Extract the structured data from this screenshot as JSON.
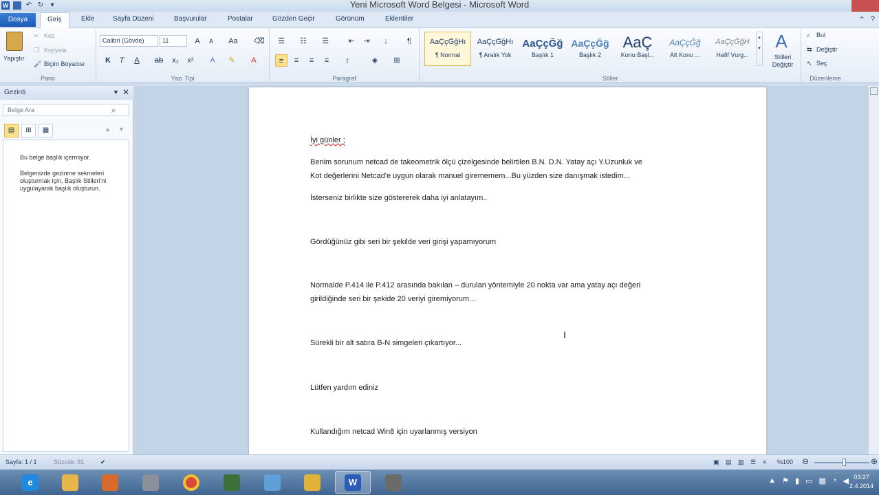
{
  "window": {
    "title": "Yeni Microsoft Word Belgesi - Microsoft Word"
  },
  "tabs": [
    {
      "label": "Dosya"
    },
    {
      "label": "Giriş"
    },
    {
      "label": "Ekle"
    },
    {
      "label": "Sayfa Düzeni"
    },
    {
      "label": "Başvurular"
    },
    {
      "label": "Postalar"
    },
    {
      "label": "Gözden Geçir"
    },
    {
      "label": "Görünüm"
    },
    {
      "label": "Eklentiler"
    }
  ],
  "clipboard": {
    "paste": "Yapıştır",
    "cut": "Kes",
    "copy": "Kopyala",
    "format_painter": "Biçim Boyacısı",
    "group": "Pano"
  },
  "font": {
    "name": "Calibri (Gövde)",
    "size": "11",
    "group": "Yazı Tipi"
  },
  "paragraph": {
    "group": "Paragraf"
  },
  "styles": {
    "group": "Stiller",
    "items": [
      {
        "preview": "AaÇçĞğHı",
        "name": "¶ Normal"
      },
      {
        "preview": "AaÇçĞğHı",
        "name": "¶ Aralık Yok"
      },
      {
        "preview": "AaÇçĞğ",
        "name": "Başlık 1"
      },
      {
        "preview": "AaÇçĞğ",
        "name": "Başlık 2"
      },
      {
        "preview": "AaÇ",
        "name": "Konu Başl..."
      },
      {
        "preview": "AaÇçĞğ",
        "name": "Alt Konu ..."
      },
      {
        "preview": "AaÇçĞğH",
        "name": "Hafif Vurg..."
      }
    ],
    "change": "Stilleri Değiştir"
  },
  "editing": {
    "find": "Bul",
    "replace": "Değiştir",
    "select": "Seç",
    "group": "Düzenleme"
  },
  "nav": {
    "title": "Gezinti",
    "search_placeholder": "Belge Ara",
    "msg1": "Bu belge başlık içermiyor.",
    "msg2": "Belgenizde gezinme sekmeleri oluşturmak için, Başlık Stilleri'ni uygulayarak başlık oluşturun."
  },
  "document": {
    "p1": "İyi günler ;",
    "p2a": "Benim sorunum netcad de takeometrik ölçü çizelgesinde belirtilen B.N. D.N. Yatay açı Y.Uzunluk ve",
    "p2b": "Kot değerlerini Netcad'e uygun olarak manuel girememem...Bu yüzden size danışmak istedim...",
    "p3": "İsterseniz birlikte size göstererek daha iyi anlatayım..",
    "p4": "Gördüğünüz gibi seri bir şekilde veri girişi yapamıyorum",
    "p5a": "Normalde P.414 ile P.412 arasında bakılan – durulan yöntemiyle 20 nokta var ama yatay açı değeri",
    "p5b": "girildiğinde seri bir şekide 20 veriyi giremiyorum...",
    "p6": "Sürekli bir alt satıra B-N simgeleri çıkartıyor...",
    "p7": "Lütfen yardım ediniz",
    "p8": "Kullandığım netcad Win8 için uyarlanmış versiyon"
  },
  "status": {
    "page": "Sayfa: 1 / 1",
    "words": "Sözcük: 81",
    "zoom": "%100"
  },
  "clock": {
    "time": "03:27",
    "date": "2.4.2014"
  },
  "colors": {
    "accent": "#1c5bb4",
    "ribbon": "#dfe9f5",
    "taskbar": "#3f6591"
  }
}
